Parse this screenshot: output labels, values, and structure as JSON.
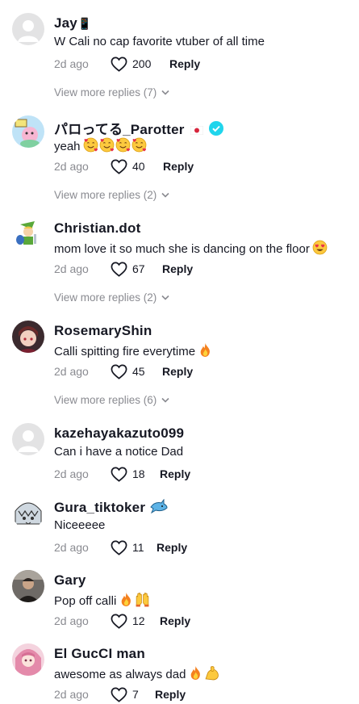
{
  "comments": [
    {
      "username": "Jay",
      "username_suffix": "📱",
      "text": "W Cali no cap favorite vtuber of all time",
      "date": "2d ago",
      "likes": "200",
      "reply_label": "Reply",
      "more_replies": "View more replies (7)",
      "avatar": "default-avatar-icon"
    },
    {
      "username": "パロってる_Parotter",
      "text": "yeah",
      "emojis": [
        "smiling-face-with-hearts",
        "smiling-face-with-hearts",
        "smiling-face-with-hearts",
        "smiling-face-with-hearts"
      ],
      "date": "2d ago",
      "likes": "40",
      "reply_label": "Reply",
      "more_replies": "View more replies (2)",
      "avatar": "pink-character-avatar"
    },
    {
      "username": "Christian.dot",
      "text": "mom love it so much she is dancing on the floor",
      "emojis": [
        "heart-eyes"
      ],
      "date": "2d ago",
      "likes": "67",
      "reply_label": "Reply",
      "more_replies": "View more replies (2)",
      "avatar": "link-character-avatar"
    },
    {
      "username": "RosemaryShin",
      "text": "Calli spitting fire everytime",
      "emojis": [
        "fire"
      ],
      "date": "2d ago",
      "likes": "45",
      "reply_label": "Reply",
      "more_replies": "View more replies (6)",
      "avatar": "anime-girl-dark-avatar"
    },
    {
      "username": "kazehayakazuto099",
      "text": "Can i have a notice Dad",
      "date": "2d ago",
      "likes": "18",
      "reply_label": "Reply",
      "avatar": "default-avatar-icon"
    },
    {
      "username": "Gura_tiktoker",
      "text": "Niceeeee",
      "date": "2d ago",
      "likes": "11",
      "reply_label": "Reply",
      "avatar": "shark-girl-avatar"
    },
    {
      "username": "Gary",
      "text": "Pop off calli",
      "emojis": [
        "fire",
        "raising-hands"
      ],
      "date": "2d ago",
      "likes": "12",
      "reply_label": "Reply",
      "avatar": "person-photo-avatar"
    },
    {
      "username": "El GucCI man",
      "text": "awesome as always dad",
      "emojis": [
        "fire",
        "flexed-biceps"
      ],
      "date": "2d ago",
      "likes": "7",
      "reply_label": "Reply",
      "avatar": "pink-hair-girl-avatar"
    }
  ],
  "colors": {
    "primary_text": "#161823",
    "secondary_text": "#8a8b91",
    "verified": "#20d5ec"
  }
}
